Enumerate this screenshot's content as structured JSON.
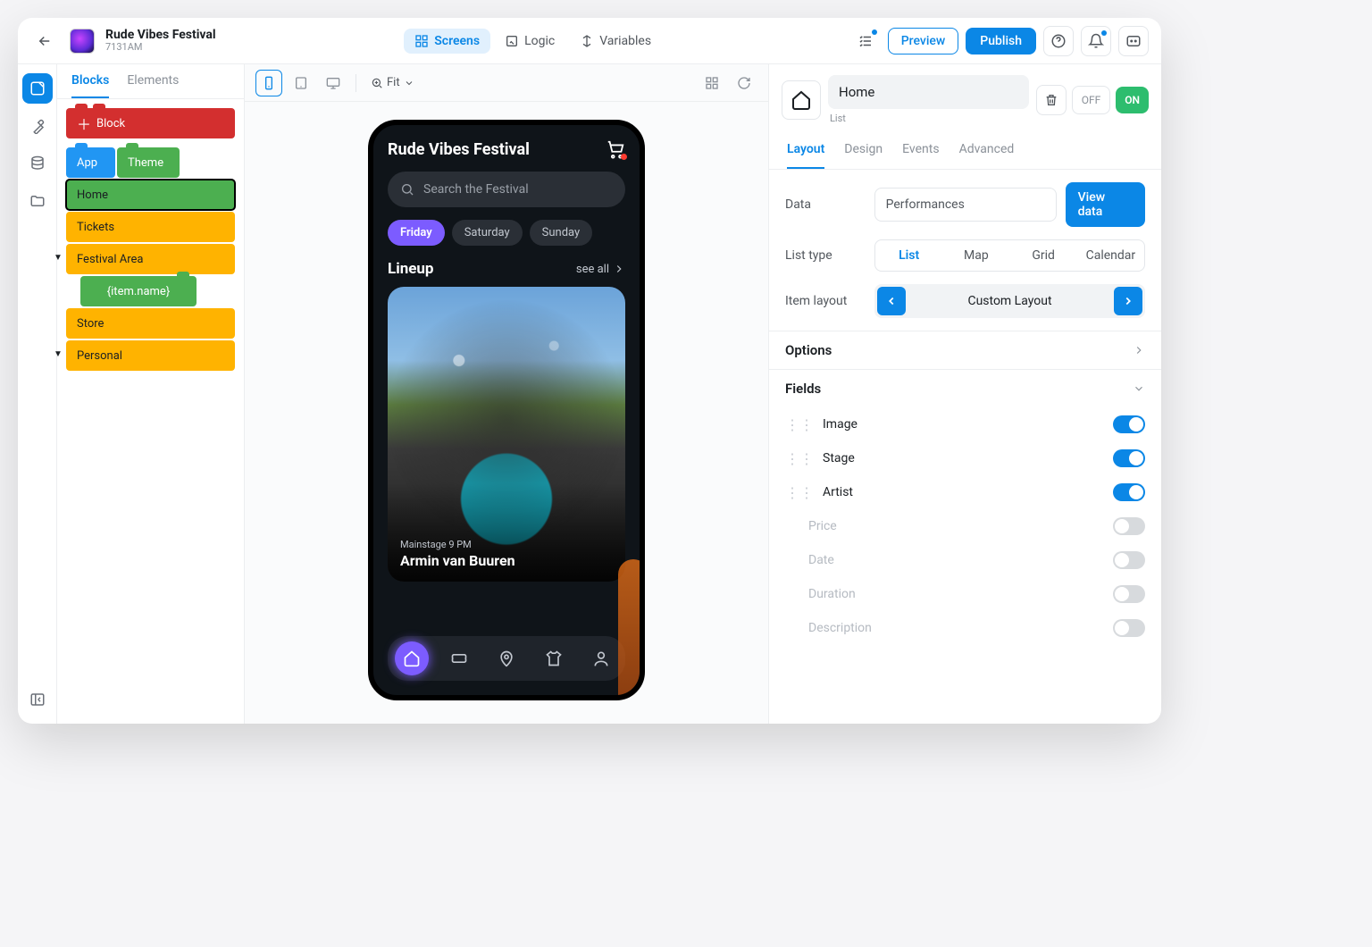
{
  "header": {
    "title": "Rude Vibes Festival",
    "subtitle": "7131AM",
    "tabs": {
      "screens": "Screens",
      "logic": "Logic",
      "variables": "Variables"
    },
    "preview": "Preview",
    "publish": "Publish"
  },
  "sidebar": {
    "tabs": {
      "blocks": "Blocks",
      "elements": "Elements"
    },
    "addBlock": "Block",
    "blocks": {
      "app": "App",
      "theme": "Theme",
      "home": "Home",
      "tickets": "Tickets",
      "festivalArea": "Festival Area",
      "itemName": "{item.name}",
      "store": "Store",
      "personal": "Personal"
    }
  },
  "canvas": {
    "zoom": "Fit"
  },
  "phone": {
    "title": "Rude Vibes Festival",
    "searchPlaceholder": "Search the Festival",
    "days": [
      "Friday",
      "Saturday",
      "Sunday"
    ],
    "lineup": "Lineup",
    "seeAll": "see all",
    "card": {
      "stage": "Mainstage 9 PM",
      "artist": "Armin van Buuren"
    }
  },
  "inspector": {
    "name": "Home",
    "subtype": "List",
    "off": "OFF",
    "on": "ON",
    "tabs": [
      "Layout",
      "Design",
      "Events",
      "Advanced"
    ],
    "dataLabel": "Data",
    "dataValue": "Performances",
    "viewData": "View data",
    "listTypeLabel": "List type",
    "listTypes": [
      "List",
      "Map",
      "Grid",
      "Calendar"
    ],
    "itemLayoutLabel": "Item layout",
    "itemLayoutValue": "Custom Layout",
    "options": "Options",
    "fieldsHeader": "Fields",
    "fields": [
      {
        "label": "Image",
        "on": true,
        "draggable": true
      },
      {
        "label": "Stage",
        "on": true,
        "draggable": true
      },
      {
        "label": "Artist",
        "on": true,
        "draggable": true
      },
      {
        "label": "Price",
        "on": false,
        "draggable": false
      },
      {
        "label": "Date",
        "on": false,
        "draggable": false
      },
      {
        "label": "Duration",
        "on": false,
        "draggable": false
      },
      {
        "label": "Description",
        "on": false,
        "draggable": false
      }
    ]
  }
}
